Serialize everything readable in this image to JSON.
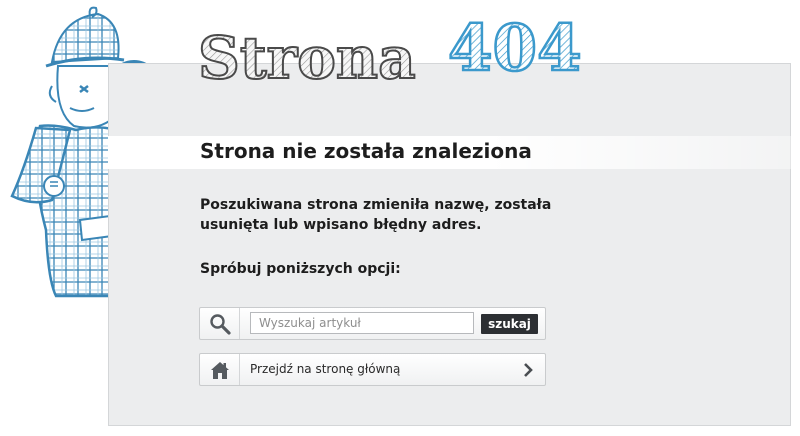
{
  "logo": {
    "word": "Strona",
    "number": "404",
    "word_color": "#f2f2f2",
    "number_color": "#3b99cc",
    "outline_color": "#4a4a4a"
  },
  "page_title": "Strona nie została znaleziona",
  "message": "Poszukiwana strona zmieniła nazwę, została usunięta lub wpisano błędny adres.",
  "options_label": "Spróbuj poniższych opcji:",
  "search": {
    "icon": "magnifier-icon",
    "placeholder": "Wyszukaj artykuł",
    "value": "",
    "button_label": "szukaj"
  },
  "home_link": {
    "icon": "house-icon",
    "label": "Przejdź na stronę główną",
    "arrow_icon": "chevron-right-icon"
  },
  "illustration": {
    "subject": "detective-with-magnifying-glass",
    "color": "#3a86b6"
  }
}
